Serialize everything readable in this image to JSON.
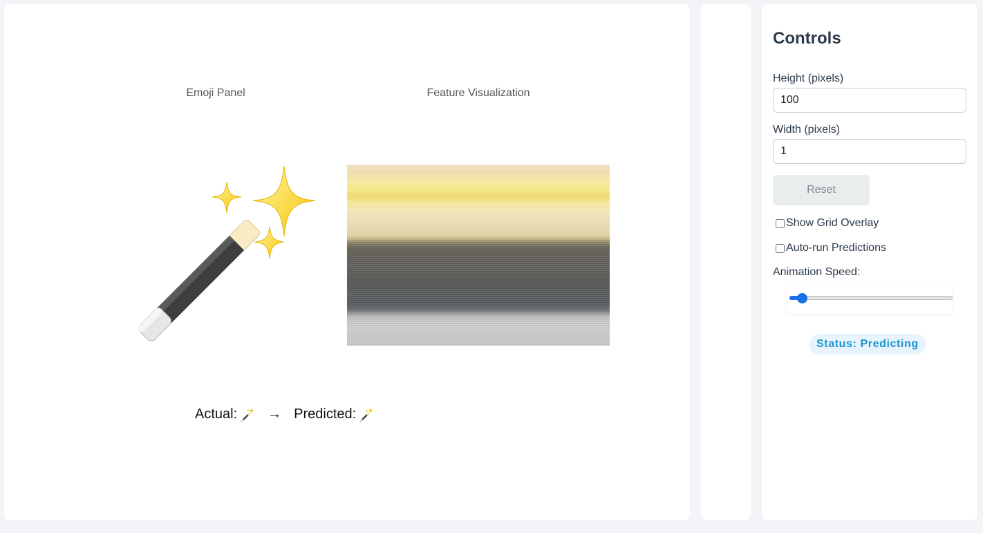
{
  "main": {
    "emoji_panel_label": "Emoji Panel",
    "feature_label": "Feature Visualization",
    "actual_label": "Actual:",
    "arrow": "→",
    "predicted_label": "Predicted:",
    "emoji_icon": "magic-wand-icon"
  },
  "controls": {
    "title": "Controls",
    "height_label": "Height (pixels)",
    "height_value": "100",
    "width_label": "Width (pixels)",
    "width_value": "1",
    "reset_label": "Reset",
    "grid_overlay_label": "Show Grid Overlay",
    "grid_overlay_checked": false,
    "autorun_label": "Auto-run Predictions",
    "autorun_checked": false,
    "speed_label": "Animation Speed:",
    "speed_fraction": 0.05,
    "status": "Status: Predicting"
  },
  "colors": {
    "accent": "#1a6fe8",
    "status_text": "#1a93d0",
    "status_bg": "#e8f4fb"
  }
}
